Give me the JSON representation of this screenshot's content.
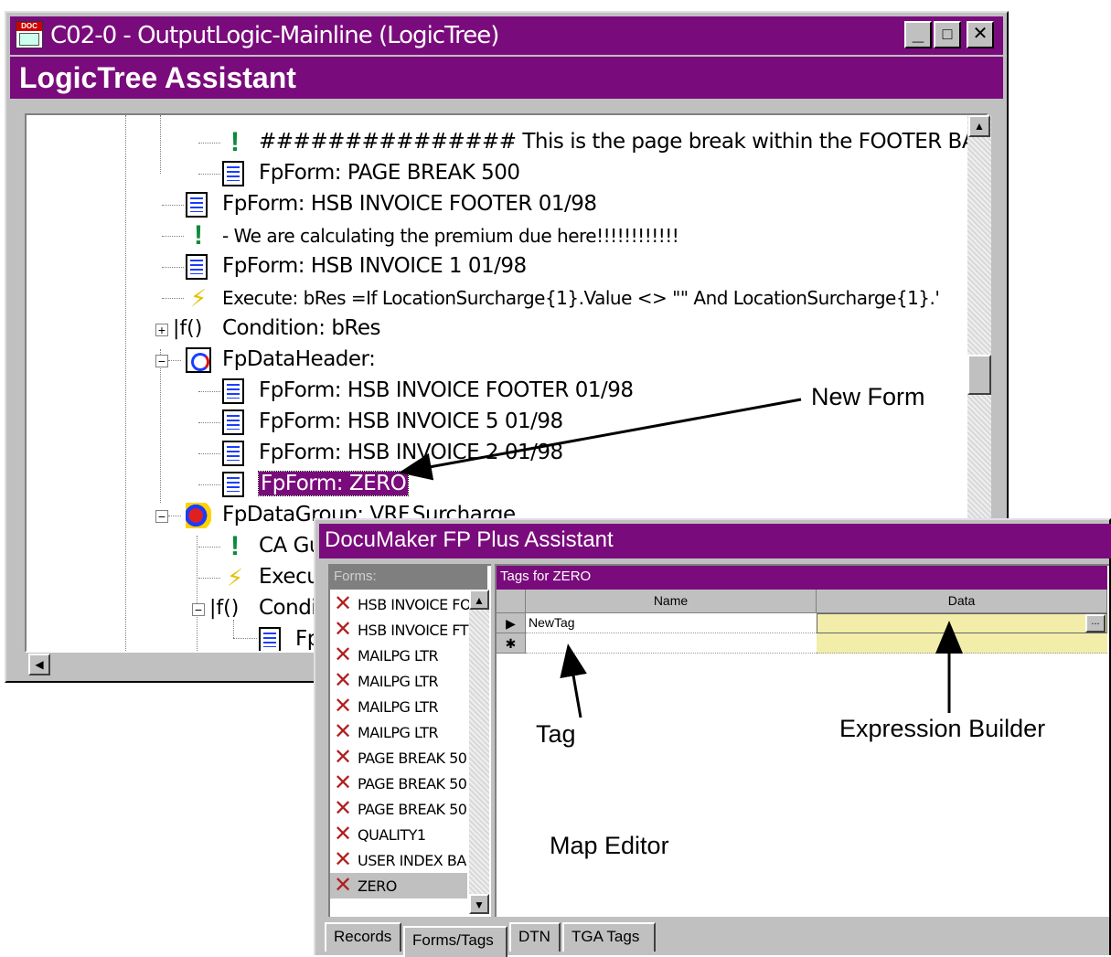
{
  "logictree": {
    "window_title": "C02-0 - OutputLogic-Mainline (LogicTree)",
    "header": "LogicTree Assistant",
    "app_icon_text": "DOC",
    "caption_buttons": {
      "minimize": "_",
      "maximize": "□",
      "close": "✕"
    },
    "scroll_up": "▲",
    "scroll_left": "◀",
    "nodes": [
      {
        "text": "############### This is the page break within the FOOTER BAND ###",
        "icon": "exclamation-icon"
      },
      {
        "text": "FpForm: PAGE BREAK 500",
        "icon": "form-document-icon"
      },
      {
        "text": "FpForm: HSB INVOICE FOOTER 01/98",
        "icon": "form-document-icon"
      },
      {
        "text": "- We are calculating the premium due here!!!!!!!!!!!!",
        "icon": "exclamation-icon"
      },
      {
        "text": "FpForm: HSB INVOICE 1 01/98",
        "icon": "form-document-icon"
      },
      {
        "text": "Execute: bRes =If LocationSurcharge{1}.Value <> \"\" And LocationSurcharge{1}.'",
        "icon": "lightning-icon"
      },
      {
        "text": "Condition: bRes",
        "icon": "if-condition-icon"
      },
      {
        "text": "FpDataHeader:",
        "icon": "data-header-icon"
      },
      {
        "text": "FpForm: HSB INVOICE FOOTER 01/98",
        "icon": "form-document-icon"
      },
      {
        "text": "FpForm: HSB INVOICE 5 01/98",
        "icon": "form-document-icon"
      },
      {
        "text": "FpForm: HSB INVOICE 2 01/98",
        "icon": "form-document-icon"
      },
      {
        "text": "FpForm: ZERO",
        "icon": "form-document-icon"
      },
      {
        "text": "FpDataGroup: VRF.Surcharge",
        "icon": "data-group-icon"
      },
      {
        "text": "CA Gu",
        "icon": "exclamation-icon"
      },
      {
        "text": "Execu",
        "icon": "lightning-icon"
      },
      {
        "text": "Condit",
        "icon": "if-condition-icon"
      },
      {
        "text": "Fp",
        "icon": "form-document-icon"
      }
    ],
    "if_glyph": "|f()",
    "expander_plus": "+",
    "expander_minus": "−"
  },
  "documaker": {
    "window_title": "DocuMaker FP Plus Assistant",
    "forms_header": "Forms:",
    "forms": [
      "HSB INVOICE FO",
      "HSB INVOICE FT",
      "MAILPG LTR",
      "MAILPG LTR",
      "MAILPG LTR",
      "MAILPG LTR",
      "PAGE BREAK 50",
      "PAGE BREAK 50",
      "PAGE BREAK 50",
      "QUALITY1",
      "USER INDEX BA",
      "ZERO"
    ],
    "forms_scroll_up": "▲",
    "forms_scroll_down": "▼",
    "tags_header": "Tags for ZERO",
    "columns": {
      "name": "Name",
      "data": "Data"
    },
    "rows": [
      {
        "selector": "▶",
        "name": "NewTag",
        "data": ""
      }
    ],
    "new_row_marker": "✱",
    "ellipsis_button": "...",
    "tabs": [
      "Records",
      "Forms/Tags",
      "DTN",
      "TGA Tags"
    ],
    "active_tab": "Forms/Tags"
  },
  "annotations": {
    "new_form": "New Form",
    "tag": "Tag",
    "expression_builder": "Expression Builder",
    "map_editor": "Map Editor"
  },
  "colors": {
    "title_purple": "#7a0b7c",
    "cell_yellow": "#f2eeaa"
  }
}
